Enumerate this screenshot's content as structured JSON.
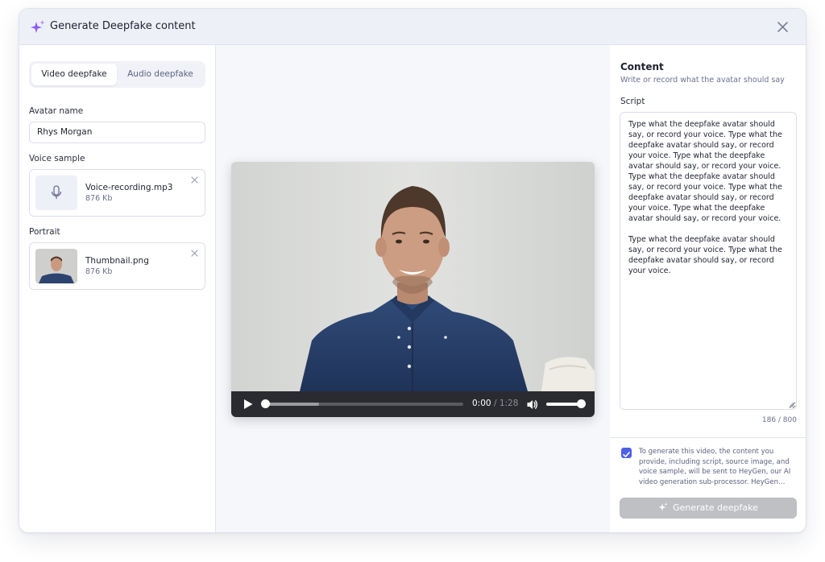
{
  "header": {
    "title": "Generate Deepfake content",
    "icon": "sparkle-icon",
    "accent": "#8b5cf6"
  },
  "left": {
    "tabs": [
      {
        "label": "Video deepfake",
        "active": true
      },
      {
        "label": "Audio deepfake",
        "active": false
      }
    ],
    "avatar_label": "Avatar name",
    "avatar_value": "Rhys Morgan",
    "voice_label": "Voice sample",
    "voice_file": {
      "name": "Voice-recording.mp3",
      "size": "876 Kb",
      "icon": "microphone-icon"
    },
    "portrait_label": "Portrait",
    "portrait_file": {
      "name": "Thumbnail.png",
      "size": "876 Kb"
    }
  },
  "player": {
    "current_time": "0:00",
    "duration": "/ 1:28",
    "progress": 0.0,
    "buffered": 0.28,
    "volume": 1.0
  },
  "right": {
    "title": "Content",
    "subtitle": "Write or record what the avatar should say",
    "script_label": "Script",
    "script_text": "Type what the deepfake avatar should say, or record your voice. Type what the deepfake avatar should say, or record your voice. Type what the deepfake avatar should say, or record your voice. Type what the deepfake avatar should say, or record your voice. Type what the deepfake avatar should say, or record your voice. Type what the deepfake avatar should say, or record your voice.\n\nType what the deepfake avatar should say, or record your voice. Type what the deepfake avatar should say, or record your voice.",
    "counter": "186 / 800",
    "consent_checked": true,
    "consent_text": "To generate this video, the content you provide, including script, source image, and voice sample, will be sent to HeyGen, our AI video generation sub-processor. HeyGen…",
    "generate_label": "Generate deepfake"
  },
  "colors": {
    "checkbox": "#4f5fe8",
    "button_disabled": "#bfc0c4",
    "player_bar": "#2a2b30"
  }
}
